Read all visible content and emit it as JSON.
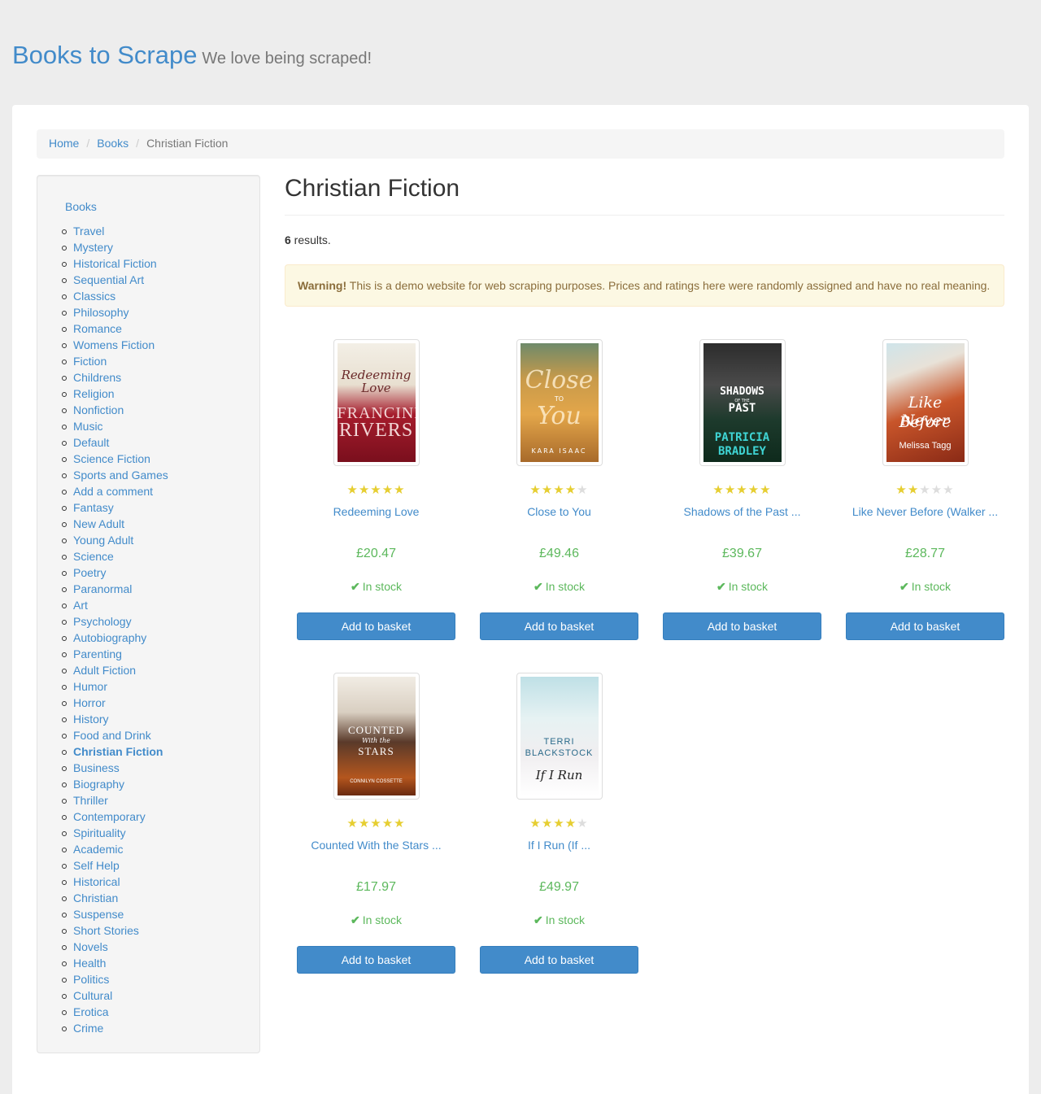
{
  "header": {
    "brand": "Books to Scrape",
    "tagline": "We love being scraped!"
  },
  "breadcrumb": {
    "home": "Home",
    "books": "Books",
    "current": "Christian Fiction"
  },
  "sidebar": {
    "root": "Books",
    "categories": [
      "Travel",
      "Mystery",
      "Historical Fiction",
      "Sequential Art",
      "Classics",
      "Philosophy",
      "Romance",
      "Womens Fiction",
      "Fiction",
      "Childrens",
      "Religion",
      "Nonfiction",
      "Music",
      "Default",
      "Science Fiction",
      "Sports and Games",
      "Add a comment",
      "Fantasy",
      "New Adult",
      "Young Adult",
      "Science",
      "Poetry",
      "Paranormal",
      "Art",
      "Psychology",
      "Autobiography",
      "Parenting",
      "Adult Fiction",
      "Humor",
      "Horror",
      "History",
      "Food and Drink",
      "Christian Fiction",
      "Business",
      "Biography",
      "Thriller",
      "Contemporary",
      "Spirituality",
      "Academic",
      "Self Help",
      "Historical",
      "Christian",
      "Suspense",
      "Short Stories",
      "Novels",
      "Health",
      "Politics",
      "Cultural",
      "Erotica",
      "Crime"
    ],
    "current": "Christian Fiction"
  },
  "main": {
    "title": "Christian Fiction",
    "results_count": "6",
    "results_suffix": " results.",
    "alert_strong": "Warning!",
    "alert_text": " This is a demo website for web scraping purposes. Prices and ratings here were randomly assigned and have no real meaning."
  },
  "products": [
    {
      "title": "Redeeming Love",
      "price": "£20.47",
      "stock": "In stock",
      "rating": 5,
      "button": "Add to basket",
      "cover_lines": [
        "Redeeming",
        "Love",
        "FRANCINE",
        "RIVERS"
      ]
    },
    {
      "title": "Close to You",
      "price": "£49.46",
      "stock": "In stock",
      "rating": 4,
      "button": "Add to basket",
      "cover_lines": [
        "Close",
        "TO",
        "You",
        "KARA ISAAC"
      ]
    },
    {
      "title": "Shadows of the Past ...",
      "price": "£39.67",
      "stock": "In stock",
      "rating": 5,
      "button": "Add to basket",
      "cover_lines": [
        "SHADOWS",
        "OF THE",
        "PAST",
        "PATRICIA",
        "BRADLEY"
      ]
    },
    {
      "title": "Like Never Before (Walker ...",
      "price": "£28.77",
      "stock": "In stock",
      "rating": 2,
      "button": "Add to basket",
      "cover_lines": [
        "Like Never",
        "Before",
        "Melissa Tagg"
      ]
    },
    {
      "title": "Counted With the Stars ...",
      "price": "£17.97",
      "stock": "In stock",
      "rating": 5,
      "button": "Add to basket",
      "cover_lines": [
        "COUNTED",
        "With the",
        "STARS",
        "CONNILYN COSSETTE"
      ]
    },
    {
      "title": "If I Run (If ...",
      "price": "£49.97",
      "stock": "In stock",
      "rating": 4,
      "button": "Add to basket",
      "cover_lines": [
        "TERRI",
        "BLACKSTOCK",
        "If I Run"
      ]
    }
  ],
  "colors": {
    "link": "#428bca",
    "price": "#5cb85c",
    "star_on": "#E6CE31",
    "star_off": "#dddddd",
    "button": "#428bca",
    "alert_bg": "#fcf8e3",
    "alert_text": "#8a6d3b"
  },
  "icons": {
    "star": "star-icon",
    "stock": "check-icon"
  }
}
